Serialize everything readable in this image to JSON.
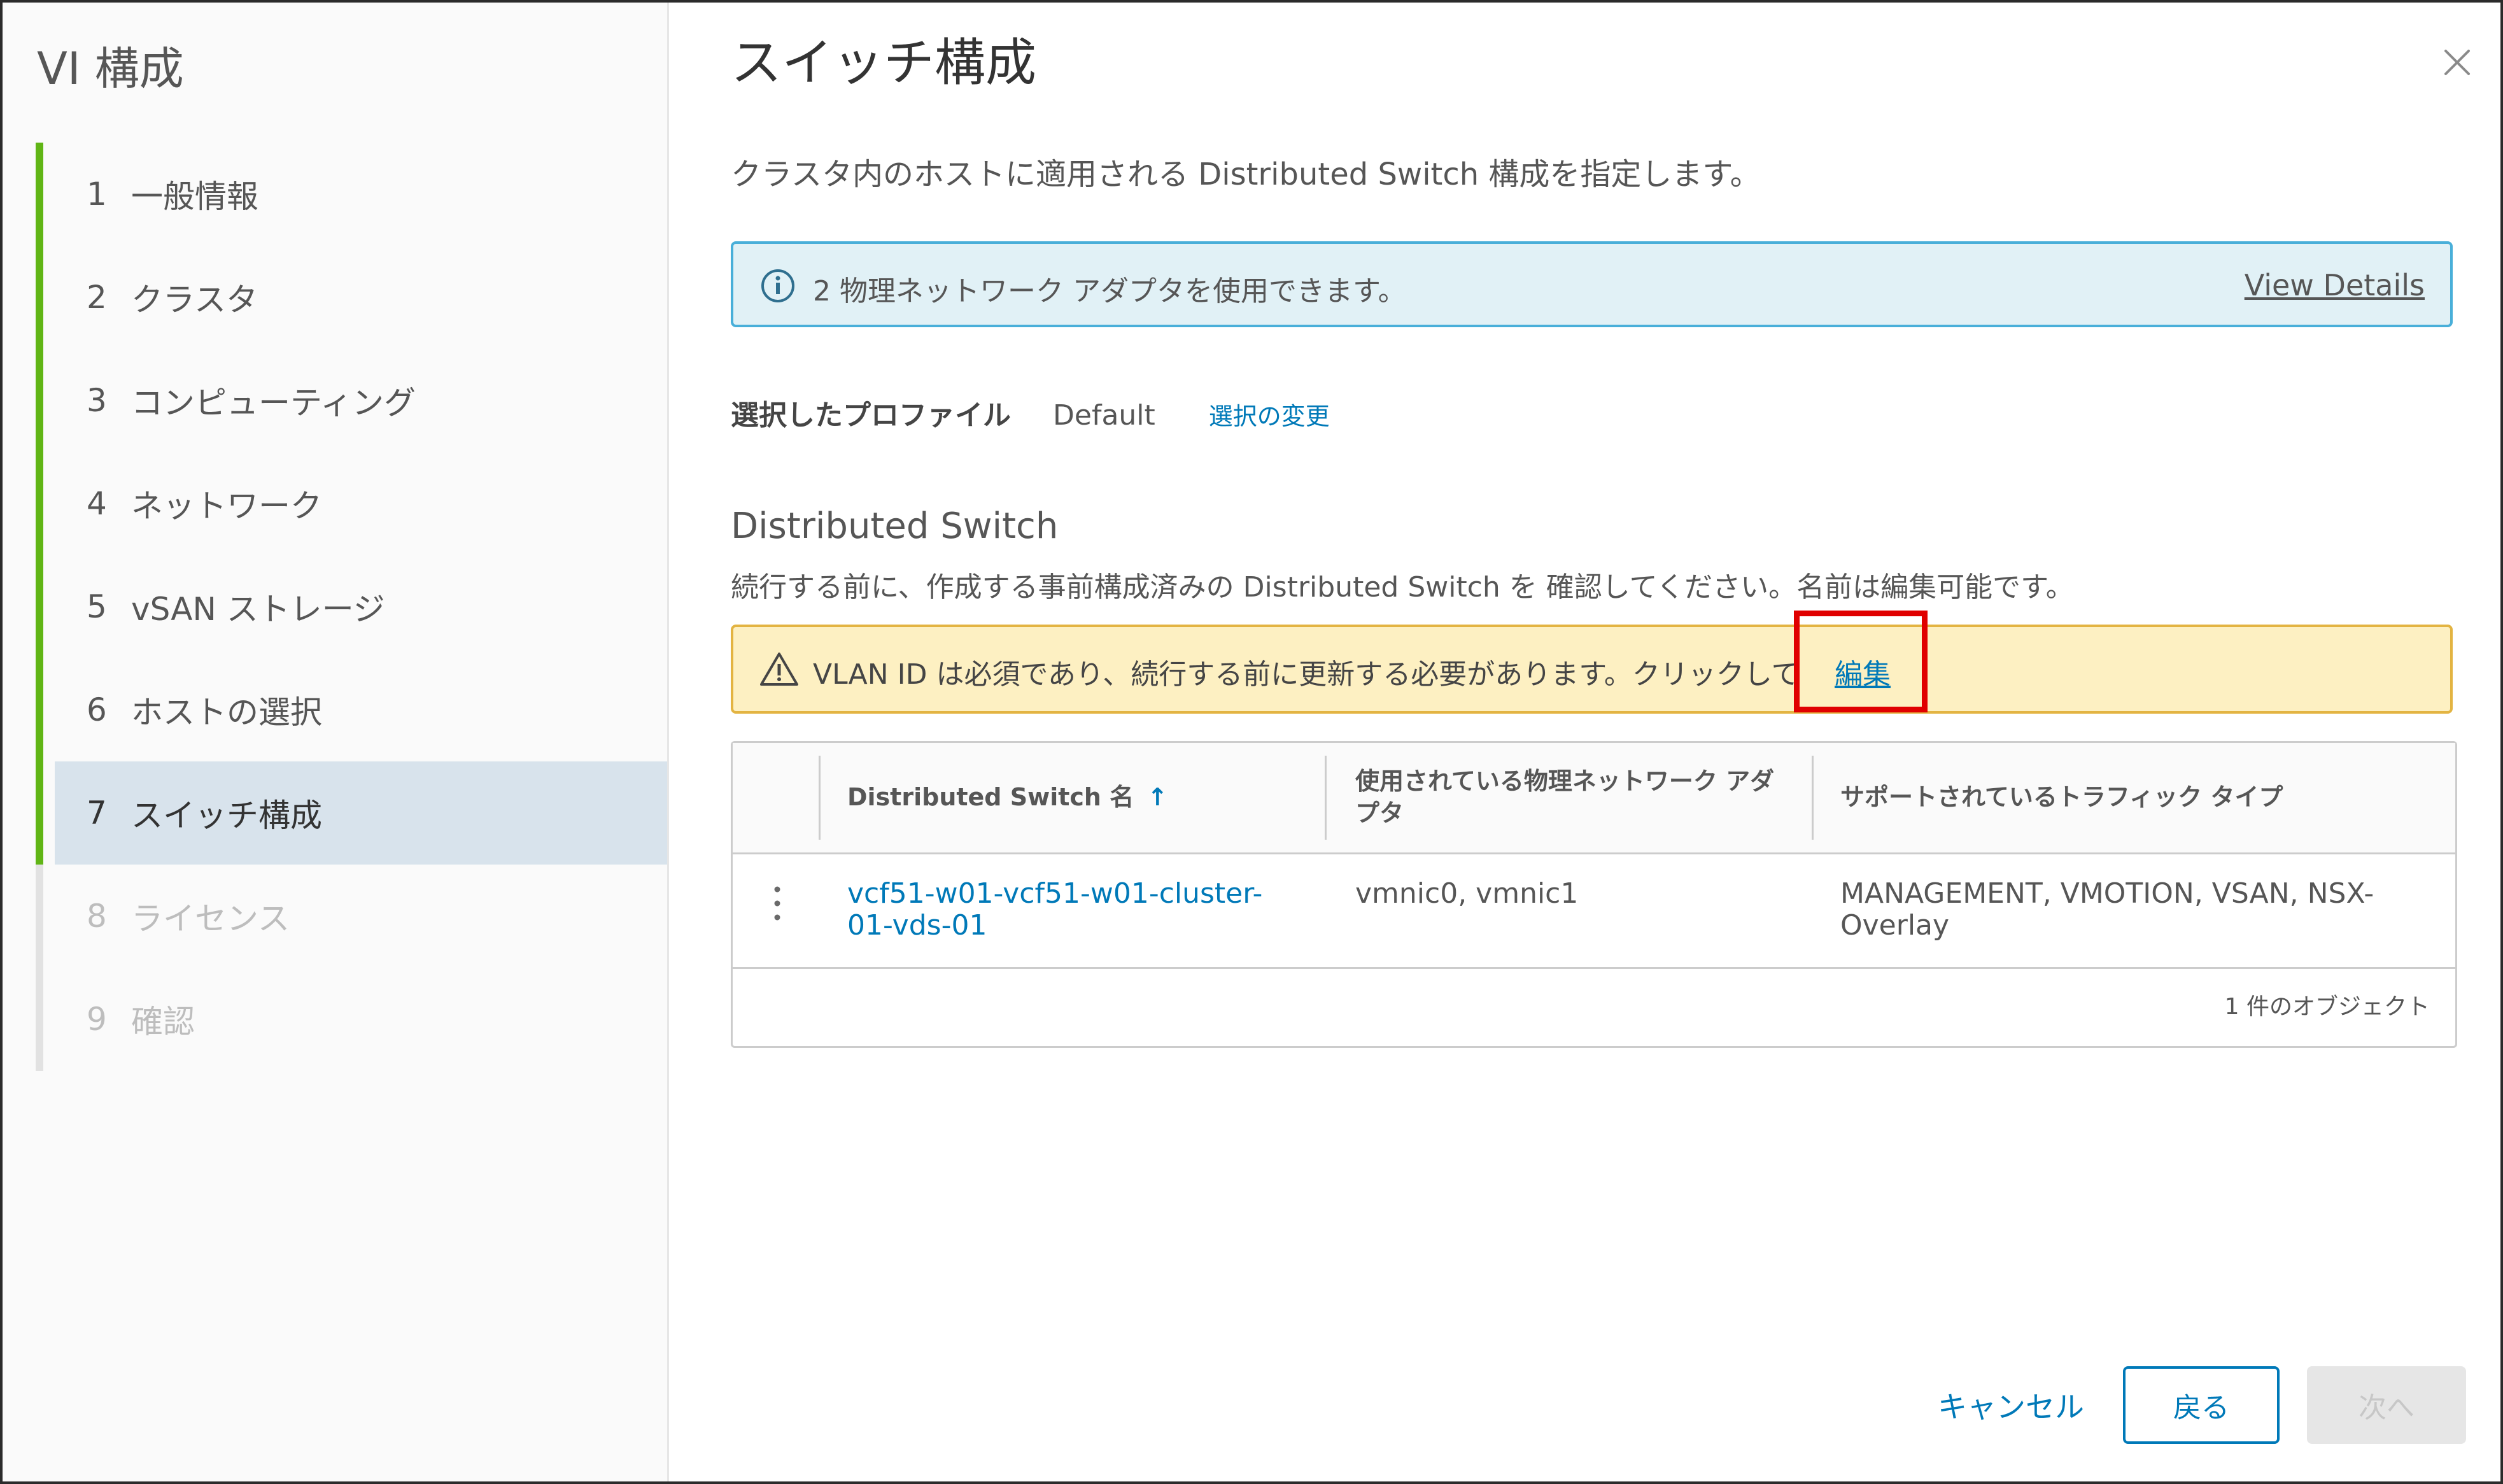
{
  "sidebar": {
    "title": "VI 構成",
    "steps": [
      {
        "num": "1",
        "label": "一般情報"
      },
      {
        "num": "2",
        "label": "クラスタ"
      },
      {
        "num": "3",
        "label": "コンピューティング"
      },
      {
        "num": "4",
        "label": "ネットワーク"
      },
      {
        "num": "5",
        "label": "vSAN ストレージ"
      },
      {
        "num": "6",
        "label": "ホストの選択"
      },
      {
        "num": "7",
        "label": "スイッチ構成"
      },
      {
        "num": "8",
        "label": "ライセンス"
      },
      {
        "num": "9",
        "label": "確認"
      }
    ]
  },
  "main": {
    "title": "スイッチ構成",
    "intro": "クラスタ内のホストに適用される Distributed Switch 構成を指定します。",
    "info_banner": {
      "text": "2 物理ネットワーク アダプタを使用できます。",
      "link": "View Details"
    },
    "profile": {
      "label": "選択したプロファイル",
      "value": "Default",
      "change_link": "選択の変更"
    },
    "section": {
      "title": "Distributed Switch",
      "description": "続行する前に、作成する事前構成済みの Distributed Switch を 確認してください。名前は編集可能です。"
    },
    "warning_banner": {
      "text": "VLAN ID は必須であり、続行する前に更新する必要があります。クリックして",
      "link": "編集"
    },
    "grid": {
      "columns": [
        "Distributed Switch 名",
        "使用されている物理ネットワーク アダプタ",
        "サポートされているトラフィック タイプ"
      ],
      "sort_indicator": "↑",
      "rows": [
        {
          "name": "vcf51-w01-vcf51-w01-cluster-01-vds-01",
          "adapters": "vmnic0, vmnic1",
          "traffic": "MANAGEMENT, VMOTION, VSAN, NSX-Overlay"
        }
      ],
      "footer": "1 件のオブジェクト"
    }
  },
  "footer": {
    "cancel": "キャンセル",
    "back": "戻る",
    "next": "次へ"
  },
  "colors": {
    "progress_green": "#60b515",
    "link_blue": "#0079b8",
    "info_border": "#49afd9",
    "warning_border": "#e3b442",
    "highlight_red": "#e00000"
  }
}
